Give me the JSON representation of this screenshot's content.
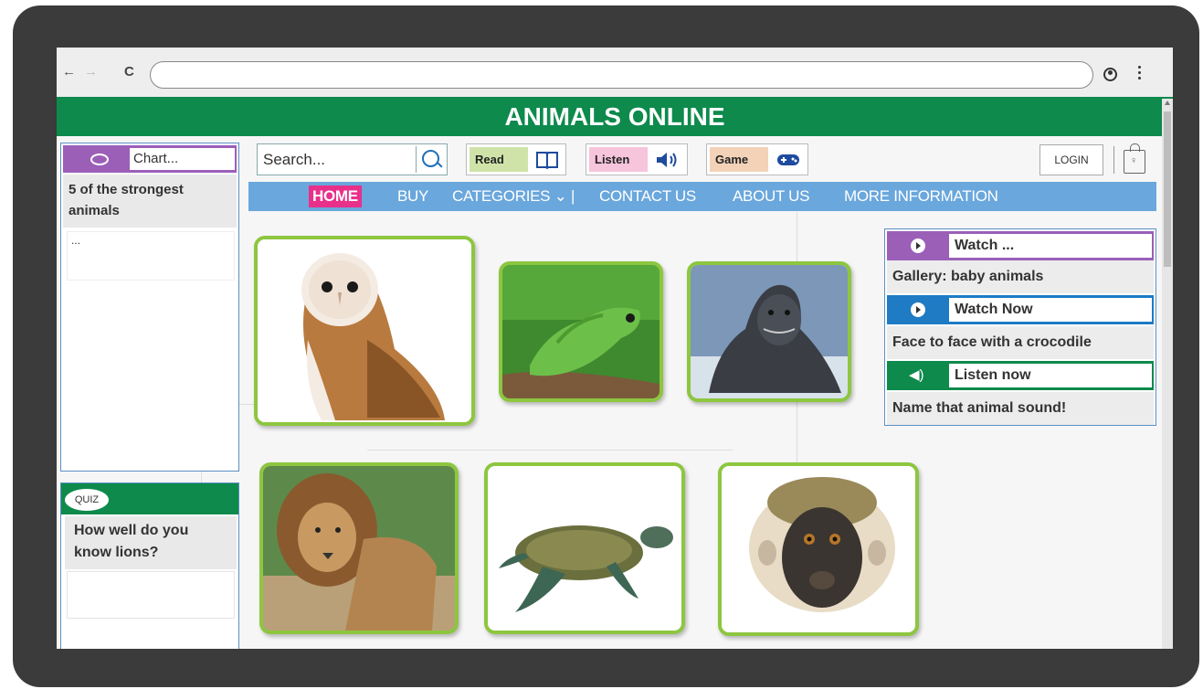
{
  "browser": {
    "back_icon": "←",
    "forward_icon": "→",
    "reload_icon": "C",
    "address": ""
  },
  "site": {
    "title": "ANIMALS ONLINE",
    "header_color": "#0d8a4c"
  },
  "chat": {
    "placeholder": "Chart...",
    "title": "5 of the strongest animals",
    "preview": "..."
  },
  "quiz": {
    "badge": "QUIZ",
    "question": "How well do you know lions?"
  },
  "toolbar": {
    "search_placeholder": "Search...",
    "read_label": "Read",
    "listen_label": "Listen",
    "game_label": "Game",
    "login_label": "LOGIN"
  },
  "nav": {
    "items": [
      "HOME",
      "BUY",
      "CATEGORIES ⌄ |",
      "CONTACT US",
      "ABOUT US",
      "MORE INFORMATION"
    ],
    "active": "HOME",
    "active_color": "#e8308a",
    "bar_color": "#6aa7dc"
  },
  "gallery": {
    "images": [
      "owl",
      "lizard",
      "seal",
      "lion",
      "turtle",
      "monkey"
    ],
    "border_color": "#8dc63f"
  },
  "media": {
    "items": [
      {
        "label": "Watch ...",
        "text": "Gallery: baby animals",
        "color": "#9b5fb8",
        "icon": "play-icon"
      },
      {
        "label": "Watch Now",
        "text": "Face to face with a crocodile",
        "color": "#1e7bc4",
        "icon": "play-icon"
      },
      {
        "label": "Listen now",
        "text": "Name that animal sound!",
        "color": "#0d8a4c",
        "icon": "speaker-icon"
      }
    ]
  }
}
